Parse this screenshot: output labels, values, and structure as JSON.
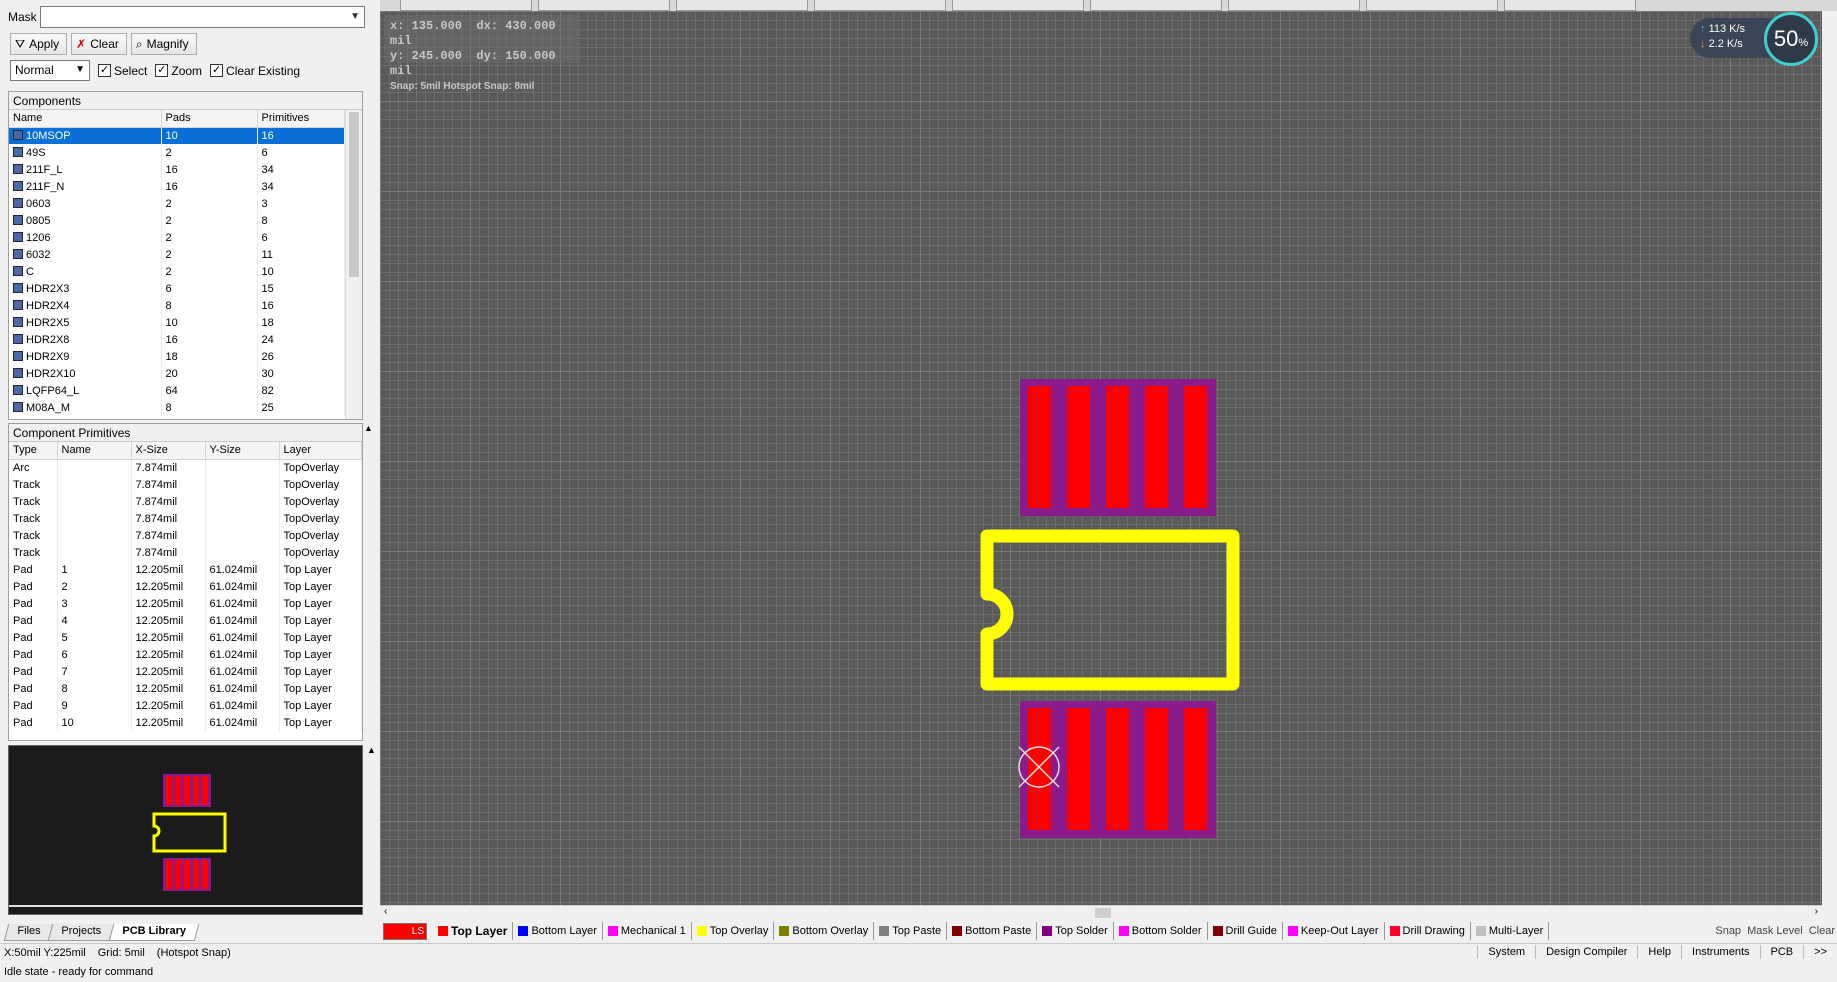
{
  "mask": {
    "label": "Mask",
    "value": ""
  },
  "toolbar": {
    "apply": "Apply",
    "clear": "Clear",
    "magnify": "Magnify"
  },
  "options": {
    "mode": "Normal",
    "select": "Select",
    "zoom": "Zoom",
    "clear_existing": "Clear Existing"
  },
  "components": {
    "title": "Components",
    "headers": [
      "Name",
      "Pads",
      "Primitives"
    ],
    "rows": [
      [
        "10MSOP",
        "10",
        "16"
      ],
      [
        "49S",
        "2",
        "6"
      ],
      [
        "211F_L",
        "16",
        "34"
      ],
      [
        "211F_N",
        "16",
        "34"
      ],
      [
        "0603",
        "2",
        "3"
      ],
      [
        "0805",
        "2",
        "8"
      ],
      [
        "1206",
        "2",
        "6"
      ],
      [
        "6032",
        "2",
        "11"
      ],
      [
        "C",
        "2",
        "10"
      ],
      [
        "HDR2X3",
        "6",
        "15"
      ],
      [
        "HDR2X4",
        "8",
        "16"
      ],
      [
        "HDR2X5",
        "10",
        "18"
      ],
      [
        "HDR2X8",
        "16",
        "24"
      ],
      [
        "HDR2X9",
        "18",
        "26"
      ],
      [
        "HDR2X10",
        "20",
        "30"
      ],
      [
        "LQFP64_L",
        "64",
        "82"
      ],
      [
        "M08A_M",
        "8",
        "25"
      ]
    ]
  },
  "primitives": {
    "title": "Component Primitives",
    "headers": [
      "Type",
      "Name",
      "X-Size",
      "Y-Size",
      "Layer"
    ],
    "rows": [
      [
        "Arc",
        "",
        "7.874mil",
        "",
        "TopOverlay"
      ],
      [
        "Track",
        "",
        "7.874mil",
        "",
        "TopOverlay"
      ],
      [
        "Track",
        "",
        "7.874mil",
        "",
        "TopOverlay"
      ],
      [
        "Track",
        "",
        "7.874mil",
        "",
        "TopOverlay"
      ],
      [
        "Track",
        "",
        "7.874mil",
        "",
        "TopOverlay"
      ],
      [
        "Track",
        "",
        "7.874mil",
        "",
        "TopOverlay"
      ],
      [
        "Pad",
        "1",
        "12.205mil",
        "61.024mil",
        "Top Layer"
      ],
      [
        "Pad",
        "2",
        "12.205mil",
        "61.024mil",
        "Top Layer"
      ],
      [
        "Pad",
        "3",
        "12.205mil",
        "61.024mil",
        "Top Layer"
      ],
      [
        "Pad",
        "4",
        "12.205mil",
        "61.024mil",
        "Top Layer"
      ],
      [
        "Pad",
        "5",
        "12.205mil",
        "61.024mil",
        "Top Layer"
      ],
      [
        "Pad",
        "6",
        "12.205mil",
        "61.024mil",
        "Top Layer"
      ],
      [
        "Pad",
        "7",
        "12.205mil",
        "61.024mil",
        "Top Layer"
      ],
      [
        "Pad",
        "8",
        "12.205mil",
        "61.024mil",
        "Top Layer"
      ],
      [
        "Pad",
        "9",
        "12.205mil",
        "61.024mil",
        "Top Layer"
      ],
      [
        "Pad",
        "10",
        "12.205mil",
        "61.024mil",
        "Top Layer"
      ]
    ]
  },
  "panel_tabs": [
    "Files",
    "Projects",
    "PCB Library"
  ],
  "coords": {
    "x": "x:  135.000",
    "dx": "dx:  430.000 mil",
    "y": "y:  245.000",
    "dy": "dy:  150.000 mil",
    "snap": "Snap: 5mil Hotspot Snap: 8mil"
  },
  "netspeed": {
    "up": "113 K/s",
    "down": "2.2 K/s",
    "percent": "50",
    "percent_unit": "%"
  },
  "layer_ls": "LS",
  "layers": [
    {
      "name": "Top Layer",
      "color": "#ff0000",
      "active": true
    },
    {
      "name": "Bottom Layer",
      "color": "#0000ff"
    },
    {
      "name": "Mechanical 1",
      "color": "#ff00ff"
    },
    {
      "name": "Top Overlay",
      "color": "#ffff00"
    },
    {
      "name": "Bottom Overlay",
      "color": "#808000"
    },
    {
      "name": "Top Paste",
      "color": "#808080"
    },
    {
      "name": "Bottom Paste",
      "color": "#800000"
    },
    {
      "name": "Top Solder",
      "color": "#800080"
    },
    {
      "name": "Bottom Solder",
      "color": "#ff00ff"
    },
    {
      "name": "Drill Guide",
      "color": "#800000"
    },
    {
      "name": "Keep-Out Layer",
      "color": "#ff00ff"
    },
    {
      "name": "Drill Drawing",
      "color": "#ff002a"
    },
    {
      "name": "Multi-Layer",
      "color": "#c0c0c0"
    }
  ],
  "layer_links": [
    "Snap",
    "Mask Level",
    "Clear"
  ],
  "status": {
    "position": "X:50mil Y:225mil",
    "grid": "Grid: 5mil",
    "snap": "(Hotspot Snap)",
    "links": [
      "System",
      "Design Compiler",
      "Help",
      "Instruments",
      "PCB",
      ">>"
    ],
    "idle": "Idle state - ready for command"
  },
  "colors": {
    "pad": "#ff0000",
    "solder": "#8b1a8b",
    "overlay": "#ffff00",
    "canvas": "#5a5a5a"
  }
}
